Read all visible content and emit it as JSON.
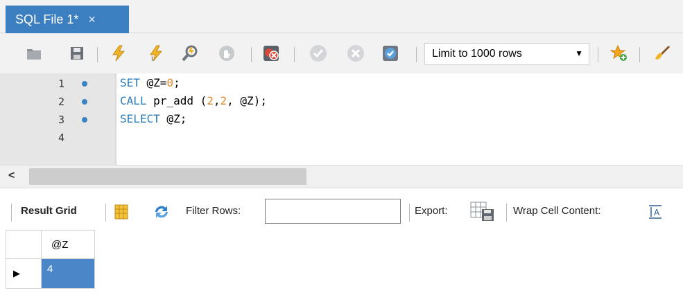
{
  "tab": {
    "title": "SQL File 1*",
    "close_glyph": "×"
  },
  "toolbar": {
    "icons": [
      "folder-icon",
      "save-icon",
      "execute-icon",
      "execute-current-icon",
      "explain-icon",
      "stop-icon",
      "toggle-error-icon",
      "commit-icon",
      "rollback-icon",
      "autocommit-icon",
      "bookmark-icon",
      "beautify-icon"
    ],
    "limit_label": "Limit to 1000 rows"
  },
  "editor": {
    "lines": [
      {
        "number": "1",
        "bullet": true
      },
      {
        "number": "2",
        "bullet": true
      },
      {
        "number": "3",
        "bullet": true
      },
      {
        "number": "4",
        "bullet": false
      }
    ],
    "line1": {
      "kw": "SET",
      "a": " @Z=",
      "num": "0",
      "end": ";"
    },
    "line2": {
      "kw": "CALL",
      "a": " pr_add (",
      "n1": "2",
      "c": ",",
      "n2": "2",
      "b": ", @Z);"
    },
    "line3": {
      "kw": "SELECT",
      "a": " @Z;"
    }
  },
  "scrollbar": {
    "left_arrow": "<"
  },
  "results": {
    "grid_label": "Result Grid",
    "filter_label": "Filter Rows:",
    "filter_value": "",
    "export_label": "Export:",
    "wrap_label": "Wrap Cell Content:",
    "column_header": "@Z",
    "row_value": "4",
    "row_marker": "▶"
  },
  "colors": {
    "tab_active": "#3c7fc1",
    "keyword": "#2a7ab8",
    "number": "#e2892c",
    "selection": "#4a86c8"
  }
}
